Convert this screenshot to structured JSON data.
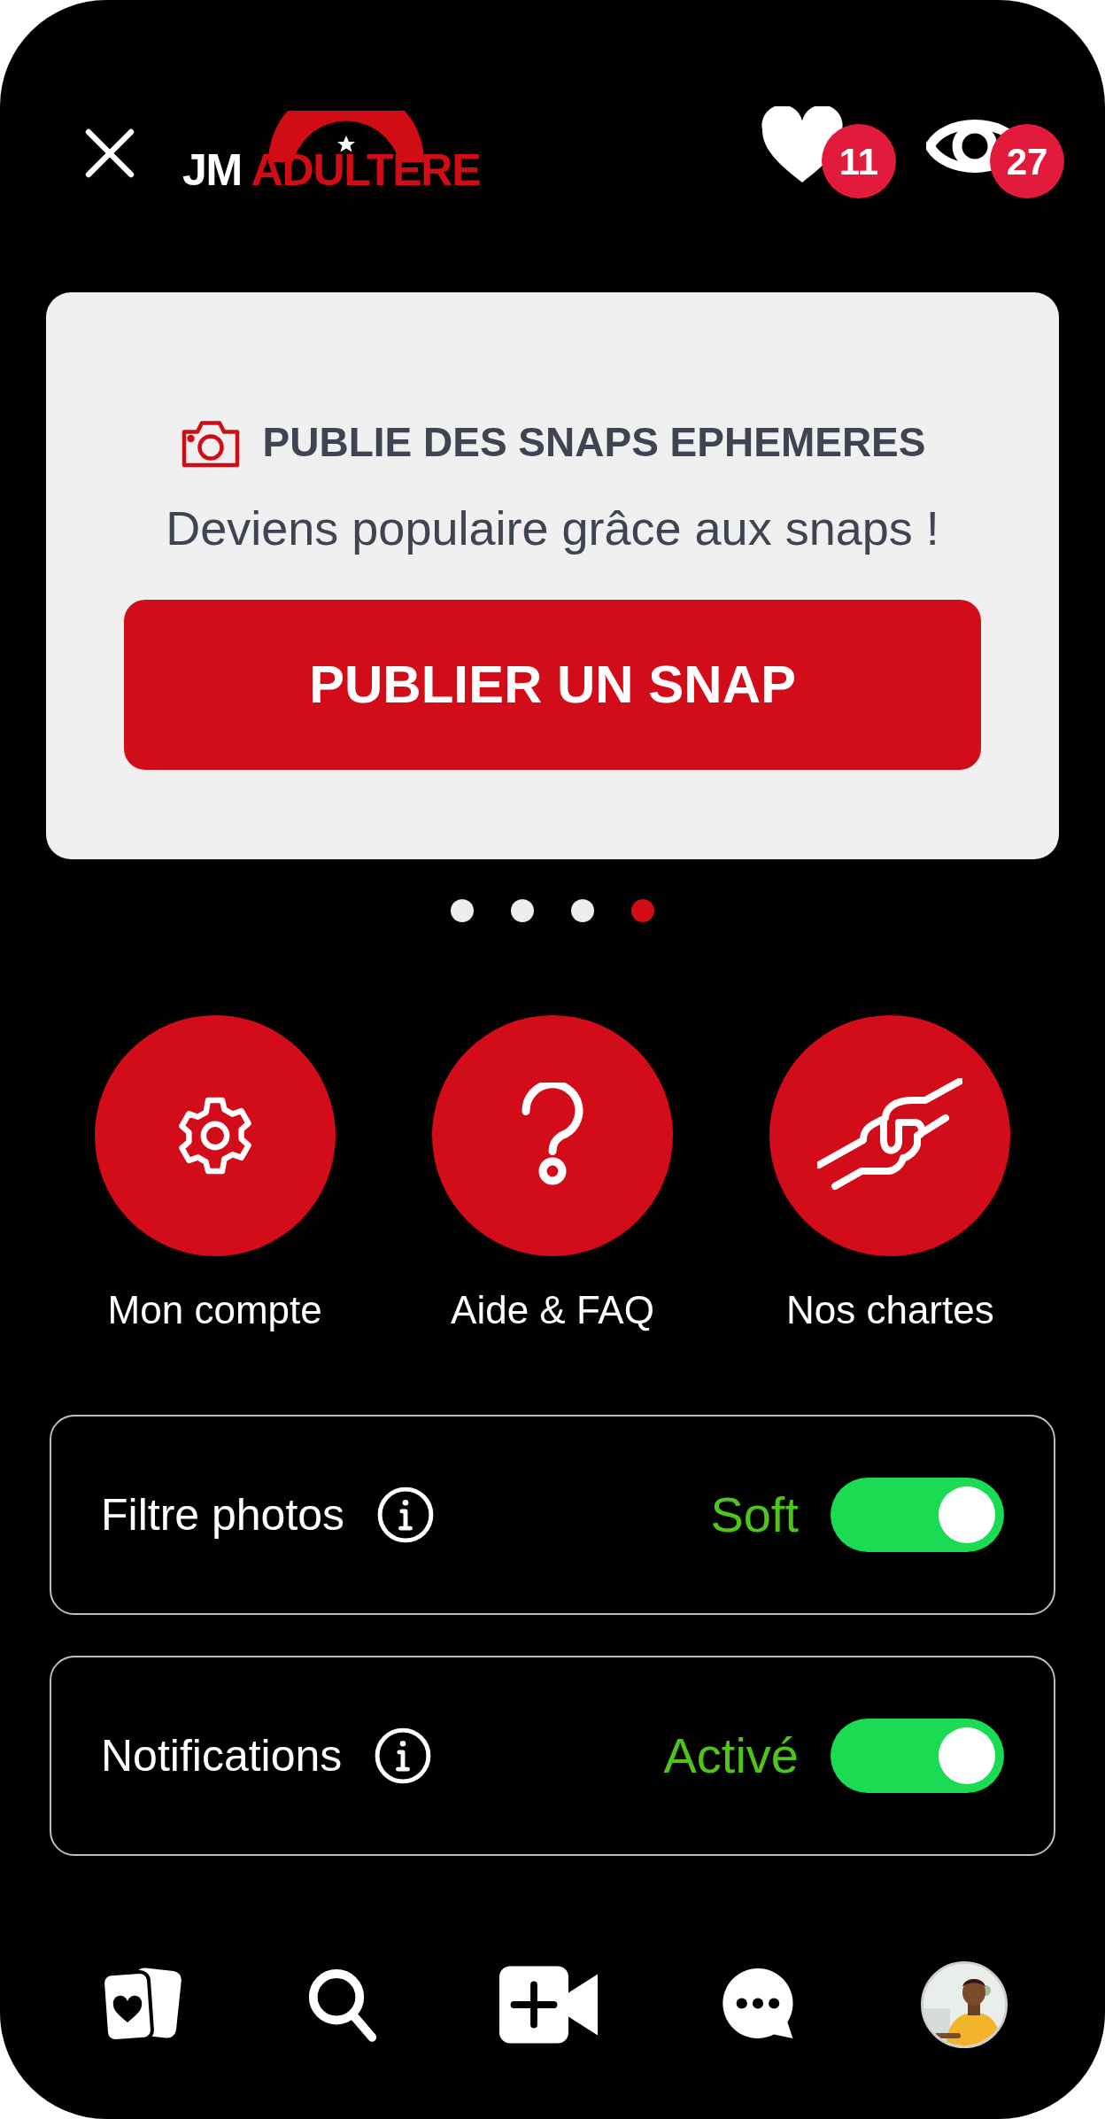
{
  "header": {
    "logo": {
      "prefix": "JM",
      "name": "ADULTERE"
    },
    "counters": [
      {
        "kind": "likes",
        "count": "11"
      },
      {
        "kind": "views",
        "count": "27"
      }
    ]
  },
  "promo": {
    "title": "PUBLIE DES SNAPS EPHEMERES",
    "subtitle": "Deviens populaire grâce aux snaps !",
    "button": "PUBLIER UN SNAP"
  },
  "carousel_dots": [
    {
      "selected": false
    },
    {
      "selected": false
    },
    {
      "selected": false
    },
    {
      "selected": true
    }
  ],
  "shortcuts": [
    {
      "kind": "settings",
      "label": "Mon compte"
    },
    {
      "kind": "help",
      "label": "Aide & FAQ"
    },
    {
      "kind": "charter",
      "label": "Nos chartes"
    }
  ],
  "settings": [
    {
      "label": "Filtre photos",
      "value": "Soft",
      "on": true
    },
    {
      "label": "Notifications",
      "value": "Activé",
      "on": true
    }
  ],
  "nav": [
    {
      "kind": "cards"
    },
    {
      "kind": "search"
    },
    {
      "kind": "video"
    },
    {
      "kind": "chat"
    },
    {
      "kind": "profile"
    }
  ]
}
